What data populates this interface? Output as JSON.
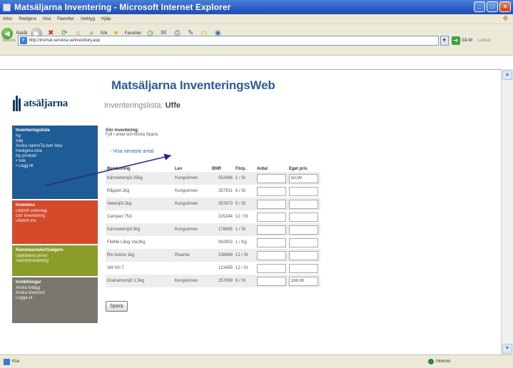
{
  "window": {
    "title": "Matsäljarna Inventering - Microsoft Internet Explorer",
    "controls": [
      "_",
      "□",
      "×"
    ]
  },
  "menu": [
    "Arkiv",
    "Redigera",
    "Visa",
    "Favoriter",
    "Verktyg",
    "Hjälp"
  ],
  "toolbar": {
    "back_label": "Bakåt",
    "search_label": "Sök",
    "favorites_label": "Favoriter"
  },
  "address": {
    "label": "Adress",
    "url": "http://invmat.servera.se/inventory.asp",
    "go_label": "Gå till",
    "links_label": "Länkar"
  },
  "page": {
    "logo_text": "atsäljarna",
    "app_title": "Matsäljarna InventeringsWeb",
    "list_title_prefix": "Inventeringslista:",
    "list_title_user": "Uffe"
  },
  "sidebar": {
    "boxes": [
      {
        "heading": "Inventeringslista",
        "items": [
          "Ny",
          "Välj",
          "Ändra namn/Ta bort lista",
          "Redigera lista",
          "Ny produkt",
          "• Sök",
          "• Lägg till"
        ]
      },
      {
        "heading": "Inventera",
        "items": [
          "Utskrift underlag",
          "Gör inventering",
          "Utskrift inv."
        ]
      },
      {
        "heading": "Rammeavtaler/Gadgets",
        "items": [
          "Uppdatera priser",
          "Sammanställning"
        ]
      },
      {
        "heading": "Inställningar",
        "items": [
          "Ändra Inlägg",
          "Ändra lösenord",
          "Logga ut"
        ]
      }
    ]
  },
  "form": {
    "heading": "Gör inventering:",
    "subheading": "Fyll i antal och klicka Spara.",
    "link_show_saved": "- Visa senaste antal",
    "columns": [
      "Benämning",
      "Lev",
      "BNR",
      "Förp.",
      "Antal",
      "Eget pris"
    ],
    "rows": [
      {
        "name": "Kärnvetemjöl 25kg",
        "lev": "Kungsörnen",
        "bnr": "052066",
        "forp": "1 / St",
        "antal": "",
        "pris": "50,00"
      },
      {
        "name": "Rågsikt 2kg",
        "lev": "Kungsörnen",
        "bnr": "257931",
        "forp": "6 / St",
        "antal": "",
        "pris": ""
      },
      {
        "name": "Vetemjöl 2kg",
        "lev": "Kungsörnen",
        "bnr": "257873",
        "forp": "5 / St",
        "antal": "",
        "pris": ""
      },
      {
        "name": "Campari 75cl",
        "lev": "",
        "bnr": "225244",
        "forp": "12 / St",
        "antal": "",
        "pris": ""
      },
      {
        "name": "Kärnvetemjöl 5kg",
        "lev": "Kungsörnen",
        "bnr": "178895",
        "forp": "1 / St",
        "antal": "",
        "pris": ""
      },
      {
        "name": "Filéfile Lång Vac3kg",
        "lev": "",
        "bnr": "062853",
        "forp": "1 / Kg",
        "antal": "",
        "pris": ""
      },
      {
        "name": "Ris Avorio 1kg",
        "lev": "Risenta",
        "bnr": "138669",
        "forp": "12 / St",
        "antal": "",
        "pris": ""
      },
      {
        "name": "Vitt Vin T",
        "lev": "",
        "bnr": "123455",
        "forp": "12 / St",
        "antal": "",
        "pris": ""
      },
      {
        "name": "Grahamsmjöl 1,5kg",
        "lev": "Kungsörnen",
        "bnr": "257899",
        "forp": "6 / St",
        "antal": "",
        "pris": "100,00"
      }
    ],
    "save_label": "Spara"
  },
  "status": {
    "text": "Klar",
    "zone": "Internet"
  },
  "colors": {
    "titlebar": "#2a5bc4",
    "brand_blue": "#2c5c9b",
    "box_blue": "#1e5c96",
    "box_red": "#d44a2b",
    "box_olive": "#8c9c2a",
    "box_grey": "#7a776f",
    "arrow": "#2a2a8a"
  }
}
